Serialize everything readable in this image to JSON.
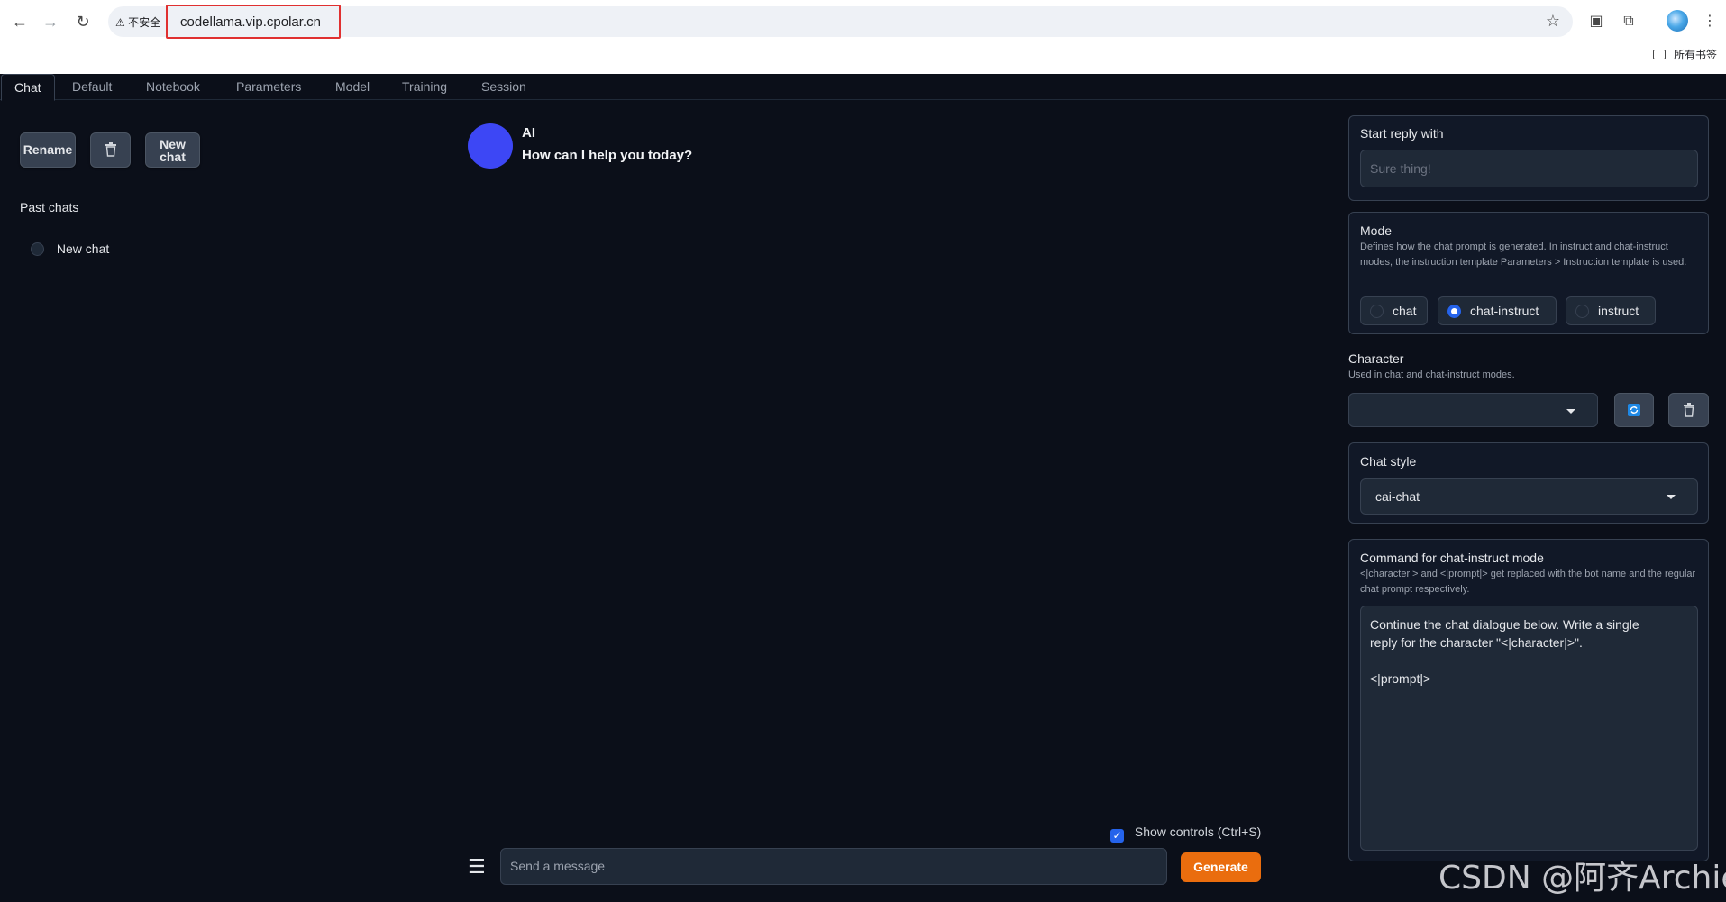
{
  "browser": {
    "insecure_label": "不安全",
    "url": "codellama.vip.cpolar.cn",
    "bookmarks_label": "所有书签"
  },
  "tabs": [
    {
      "label": "Chat",
      "active": true
    },
    {
      "label": "Default"
    },
    {
      "label": "Notebook"
    },
    {
      "label": "Parameters"
    },
    {
      "label": "Model"
    },
    {
      "label": "Training"
    },
    {
      "label": "Session"
    }
  ],
  "left": {
    "rename_label": "Rename",
    "new_chat_label_line1": "New",
    "new_chat_label_line2": "chat",
    "past_chats_label": "Past chats",
    "chats": [
      {
        "label": "New chat",
        "selected": false
      }
    ]
  },
  "chat": {
    "sender": "AI",
    "message": "How can I help you today?",
    "show_controls_label": "Show controls (Ctrl+S)",
    "show_controls_checked": true,
    "input_placeholder": "Send a message",
    "generate_label": "Generate"
  },
  "right": {
    "start_reply": {
      "title": "Start reply with",
      "placeholder": "Sure thing!"
    },
    "mode": {
      "title": "Mode",
      "description": "Defines how the chat prompt is generated. In instruct and chat-instruct modes, the instruction template Parameters > Instruction template is used.",
      "options": [
        "chat",
        "chat-instruct",
        "instruct"
      ],
      "selected": "chat-instruct"
    },
    "character": {
      "title": "Character",
      "description": "Used in chat and chat-instruct modes.",
      "value": ""
    },
    "chat_style": {
      "title": "Chat style",
      "value": "cai-chat"
    },
    "command": {
      "title": "Command for chat-instruct mode",
      "description": "<|character|> and <|prompt|> get replaced with the bot name and the regular chat prompt respectively.",
      "value_line1": "Continue the chat dialogue below. Write a single",
      "value_line2": "reply for the character \"<|character|>\".",
      "value_line3": "<|prompt|>"
    }
  },
  "watermark": "CSDN @阿齐Archie",
  "colors": {
    "accent": "#2563eb",
    "generate": "#ea6d0e",
    "avatar": "#3d47f5",
    "background": "#0b0f19"
  }
}
